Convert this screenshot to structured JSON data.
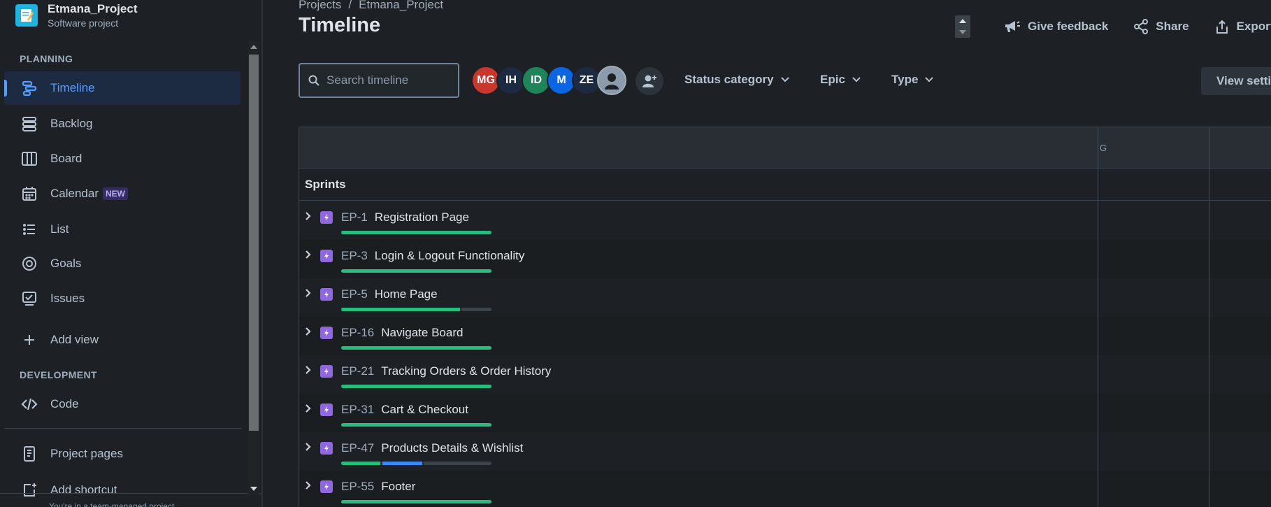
{
  "sidebar": {
    "project_name": "Etmana_Project",
    "project_type": "Software project",
    "planning_title": "PLANNING",
    "development_title": "DEVELOPMENT",
    "items": [
      {
        "label": "Timeline",
        "icon": "timeline-icon",
        "active": true
      },
      {
        "label": "Backlog",
        "icon": "backlog-icon"
      },
      {
        "label": "Board",
        "icon": "board-icon"
      },
      {
        "label": "Calendar",
        "icon": "calendar-icon",
        "badge": "NEW"
      },
      {
        "label": "List",
        "icon": "list-icon"
      },
      {
        "label": "Goals",
        "icon": "goals-icon"
      },
      {
        "label": "Issues",
        "icon": "issues-icon"
      },
      {
        "label": "Add view",
        "icon": "plus-icon"
      }
    ],
    "code_label": "Code",
    "project_pages_label": "Project pages",
    "add_shortcut_label": "Add shortcut",
    "footer_text": "You're in a team-managed project"
  },
  "header": {
    "breadcrumb": [
      "Projects",
      "Etmana_Project"
    ],
    "breadcrumb_sep": "/",
    "title": "Timeline",
    "actions": {
      "feedback": "Give feedback",
      "share": "Share",
      "export": "Export"
    }
  },
  "toolbar": {
    "search_placeholder": "Search timeline",
    "avatars": [
      {
        "initials": "MG",
        "color": "#c9372c"
      },
      {
        "initials": "IH",
        "color": "#1c2b41"
      },
      {
        "initials": "ID",
        "color": "#1f845a"
      },
      {
        "initials": "M",
        "color": "#0c66e4"
      },
      {
        "initials": "ZE",
        "color": "#1c2b41"
      },
      {
        "initials": "",
        "color": "#8c9bab"
      }
    ],
    "filters": {
      "status": "Status category",
      "epic": "Epic",
      "type": "Type"
    },
    "view_settings": "View settings"
  },
  "timeline": {
    "month_label": "G",
    "sprints_label": "Sprints",
    "epics": [
      {
        "key": "EP-1",
        "summary": "Registration Page",
        "done": 1.0,
        "in_progress": 0,
        "todo": 0
      },
      {
        "key": "EP-3",
        "summary": "Login & Logout Functionality",
        "done": 1.0,
        "in_progress": 0,
        "todo": 0
      },
      {
        "key": "EP-5",
        "summary": "Home Page",
        "done": 0.8,
        "in_progress": 0,
        "todo": 0.2
      },
      {
        "key": "EP-16",
        "summary": "Navigate Board",
        "done": 1.0,
        "in_progress": 0,
        "todo": 0
      },
      {
        "key": "EP-21",
        "summary": "Tracking Orders & Order History",
        "done": 1.0,
        "in_progress": 0,
        "todo": 0
      },
      {
        "key": "EP-31",
        "summary": "Cart & Checkout",
        "done": 1.0,
        "in_progress": 0,
        "todo": 0
      },
      {
        "key": "EP-47",
        "summary": "Products Details & Wishlist",
        "done": 0.27,
        "in_progress": 0.27,
        "todo": 0.46
      },
      {
        "key": "EP-55",
        "summary": "Footer",
        "done": 1.0,
        "in_progress": 0,
        "todo": 0
      }
    ]
  },
  "colors": {
    "accent": "#579dff",
    "done": "#2abb7f",
    "in_progress": "#388bff",
    "epic": "#8f68e0"
  }
}
